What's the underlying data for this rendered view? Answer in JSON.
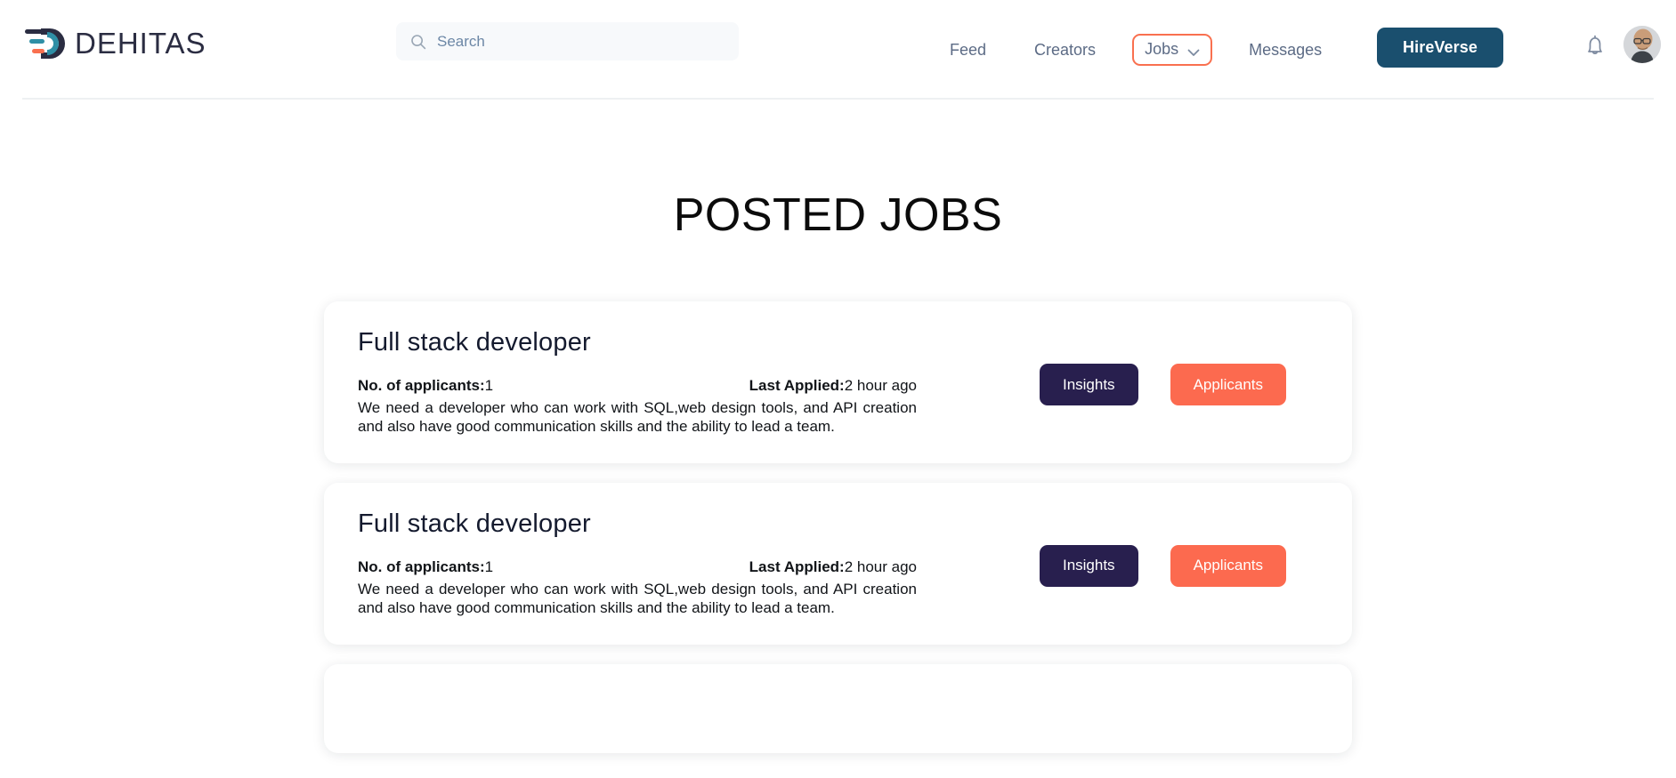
{
  "brand": {
    "name": "DEHITAS",
    "logo_icon": "dehitas-logo-mark",
    "colors": {
      "navy": "#2b2d42",
      "teal": "#2f8fa6",
      "coral": "#f9704f"
    }
  },
  "header": {
    "search": {
      "placeholder": "Search",
      "value": "",
      "icon": "search-icon"
    },
    "nav": [
      {
        "label": "Feed",
        "type": "link"
      },
      {
        "label": "Creators",
        "type": "link"
      },
      {
        "label": "Jobs",
        "type": "dropdown",
        "icon": "chevron-down-icon",
        "highlighted": true
      },
      {
        "label": "Messages",
        "type": "link"
      }
    ],
    "cta": {
      "label": "HireVerse",
      "color": "#1a4f6e"
    },
    "notifications": {
      "icon": "bell-icon"
    },
    "avatar": {
      "icon": "user-avatar"
    }
  },
  "main": {
    "title": "POSTED JOBS",
    "labels": {
      "applicants": "No. of applicants:",
      "last_applied": "Last Applied:"
    },
    "buttons": {
      "insights": "Insights",
      "applicants": "Applicants"
    },
    "jobs": [
      {
        "title": "Full stack developer",
        "applicants": "1",
        "last_applied": "2 hour ago",
        "description": "We need a developer who can work with SQL,web design tools, and API creation and also have good communication skills and the ability to lead a team."
      },
      {
        "title": "Full stack developer",
        "applicants": "1",
        "last_applied": "2 hour ago",
        "description": "We need a developer who can work with SQL,web design tools, and API creation and also have good communication skills and the ability to lead a team."
      },
      {
        "title": "",
        "applicants": "",
        "last_applied": "",
        "description": ""
      }
    ]
  }
}
